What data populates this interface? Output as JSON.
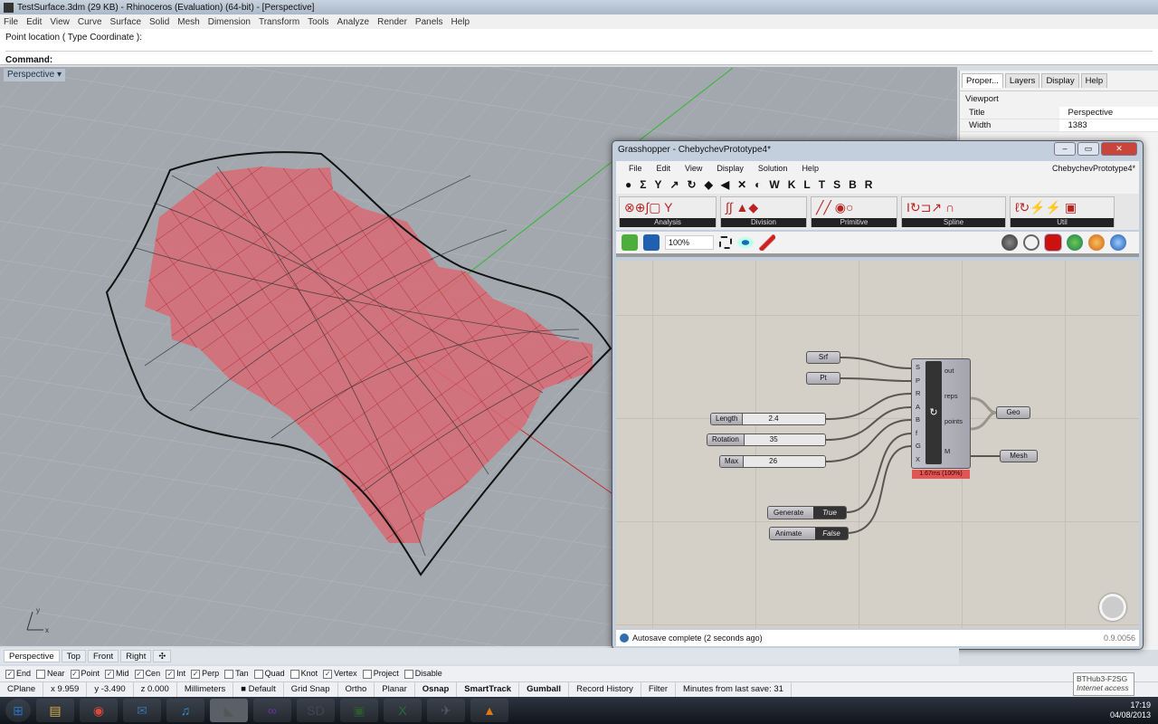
{
  "app": {
    "title": "TestSurface.3dm (29 KB) - Rhinoceros (Evaluation) (64-bit) - [Perspective]"
  },
  "menu": [
    "File",
    "Edit",
    "View",
    "Curve",
    "Surface",
    "Solid",
    "Mesh",
    "Dimension",
    "Transform",
    "Tools",
    "Analyze",
    "Render",
    "Panels",
    "Help"
  ],
  "command": {
    "prompt": "Point location ( Type  Coordinate ):",
    "label": "Command:"
  },
  "viewport": {
    "label": "Perspective",
    "dropdown": "▾",
    "axis_x": "x",
    "axis_y": "y"
  },
  "panel": {
    "tabs": [
      "Proper...",
      "Layers",
      "Display",
      "Help"
    ],
    "section": "Viewport",
    "rows": [
      {
        "k": "Title",
        "v": "Perspective"
      },
      {
        "k": "Width",
        "v": "1383"
      }
    ]
  },
  "grasshopper": {
    "title": "Grasshopper - ChebychevPrototype4*",
    "menu": [
      "File",
      "Edit",
      "View",
      "Display",
      "Solution",
      "Help"
    ],
    "doc": "ChebychevPrototype4*",
    "tabs": [
      "●",
      "Σ",
      "Y",
      "↗",
      "↻",
      "◆",
      "◀",
      "✕",
      "◐",
      "W",
      "K",
      "L",
      "T",
      "S",
      "B",
      "R"
    ],
    "ribbon": [
      {
        "label": "Analysis",
        "icons": "⊗⊕∫▢ Y"
      },
      {
        "label": "Division",
        "icons": "∫∫ ▲◆"
      },
      {
        "label": "Primitive",
        "icons": "╱╱ ◉○"
      },
      {
        "label": "Spline",
        "icons": "I↻⊐↗ ∩"
      },
      {
        "label": "Util",
        "icons": "ℓ↻⚡⚡ ▣"
      }
    ],
    "zoom": "100%",
    "status": "Autosave complete (2 seconds ago)",
    "version": "0.9.0056",
    "params": {
      "srf": "Srf",
      "pt": "Pt",
      "geo": "Geo",
      "mesh": "Mesh"
    },
    "sliders": [
      {
        "name": "Length",
        "value": "2.4"
      },
      {
        "name": "Rotation",
        "value": "35"
      },
      {
        "name": "Max",
        "value": "26"
      }
    ],
    "toggles": [
      {
        "name": "Generate",
        "value": "True"
      },
      {
        "name": "Animate",
        "value": "False"
      }
    ],
    "component": {
      "inputs": [
        "S",
        "P",
        "R",
        "A",
        "B",
        "f",
        "G",
        "X"
      ],
      "outputs": [
        "out",
        "reps",
        "points",
        "M"
      ],
      "timing": "1.67ms (100%)",
      "icon": "↻"
    }
  },
  "view_tabs": [
    "Perspective",
    "Top",
    "Front",
    "Right",
    "✣"
  ],
  "osnap": [
    {
      "label": "End",
      "checked": true
    },
    {
      "label": "Near",
      "checked": false
    },
    {
      "label": "Point",
      "checked": true
    },
    {
      "label": "Mid",
      "checked": true
    },
    {
      "label": "Cen",
      "checked": true
    },
    {
      "label": "Int",
      "checked": true
    },
    {
      "label": "Perp",
      "checked": true
    },
    {
      "label": "Tan",
      "checked": false
    },
    {
      "label": "Quad",
      "checked": false
    },
    {
      "label": "Knot",
      "checked": false
    },
    {
      "label": "Vertex",
      "checked": true
    },
    {
      "label": "Project",
      "checked": false
    },
    {
      "label": "Disable",
      "checked": false
    }
  ],
  "status": [
    {
      "t": "CPlane"
    },
    {
      "t": "x 9.959"
    },
    {
      "t": "y -3.490"
    },
    {
      "t": "z 0.000"
    },
    {
      "t": "Millimeters"
    },
    {
      "t": "■ Default"
    },
    {
      "t": "Grid Snap"
    },
    {
      "t": "Ortho"
    },
    {
      "t": "Planar"
    },
    {
      "t": "Osnap",
      "b": true
    },
    {
      "t": "SmartTrack",
      "b": true
    },
    {
      "t": "Gumball",
      "b": true
    },
    {
      "t": "Record History"
    },
    {
      "t": "Filter"
    },
    {
      "t": "Minutes from last save: 31"
    }
  ],
  "taskbar": {
    "apps": [
      {
        "name": "start",
        "g": "⊞",
        "c": "#2a6fc4"
      },
      {
        "name": "explorer",
        "g": "▤",
        "c": "#d9b34a"
      },
      {
        "name": "chrome",
        "g": "◉",
        "c": "#d84a3a"
      },
      {
        "name": "thunderbird",
        "g": "✉",
        "c": "#3a6ea5"
      },
      {
        "name": "itunes",
        "g": "♫",
        "c": "#3a8ad8"
      },
      {
        "name": "rhino",
        "g": "◣",
        "c": "#555"
      },
      {
        "name": "visual-studio",
        "g": "∞",
        "c": "#6b2fa0"
      },
      {
        "name": "sketchup",
        "g": "SD",
        "c": "#445"
      },
      {
        "name": "terminal",
        "g": "▣",
        "c": "#2d5a2d"
      },
      {
        "name": "excel",
        "g": "X",
        "c": "#2d6a3d"
      },
      {
        "name": "network",
        "g": "✈",
        "c": "#556"
      },
      {
        "name": "vlc",
        "g": "▲",
        "c": "#e07a10"
      }
    ],
    "time": "17:19",
    "date": "04/08/2013",
    "tooltip_title": "BTHub3-F2SG",
    "tooltip_sub": "Internet access"
  }
}
